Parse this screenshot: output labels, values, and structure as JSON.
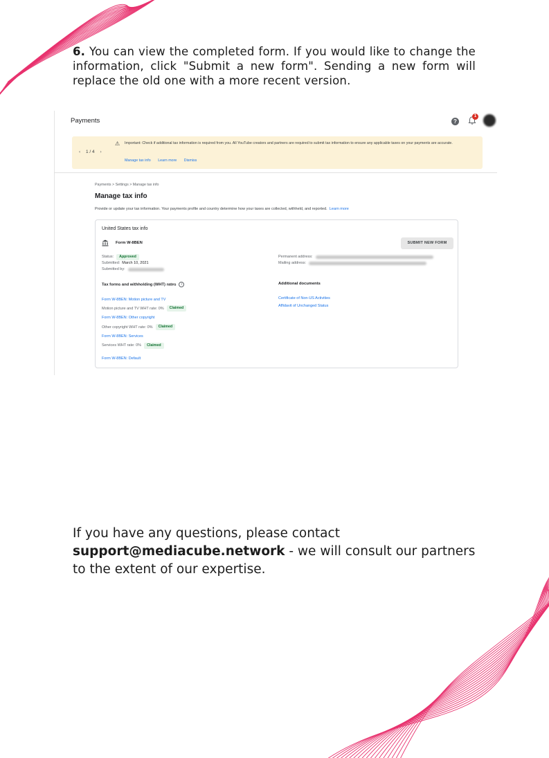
{
  "intro": {
    "step_num": "6.",
    "text": " You can view the completed form. If you would like to change the information, click \"Submit a new form\". Sending a new form will replace the old one with a more recent version."
  },
  "screenshot": {
    "topbar": {
      "title": "Payments",
      "notification_count": "1"
    },
    "banner": {
      "pager": "1 / 4",
      "prev_glyph": "‹",
      "next_glyph": "›",
      "text": "Important: Check if additional tax information is required from you. All YouTube creators and partners are required to submit tax information to ensure any applicable taxes on your payments are accurate.",
      "links": [
        "Manage tax info",
        "Learn more",
        "Dismiss"
      ]
    },
    "breadcrumb": "Payments  >  Settings  >  Manage tax info",
    "title": "Manage tax info",
    "description": "Provide or update your tax information. Your payments profile and country determine how your taxes are collected, withheld, and reported.",
    "description_link": "Learn more",
    "card": {
      "title": "United States tax info",
      "form_name": "Form W-8BEN",
      "submit_button": "SUBMIT NEW FORM",
      "status_label": "Status:",
      "status_value": "Approved",
      "submitted_label": "Submitted:",
      "submitted_value": "March 10, 2021",
      "submitted_by_label": "Submitted by:",
      "permanent_address_label": "Permanent address:",
      "mailing_address_label": "Mailing address:",
      "wht_heading": "Tax forms and withholding (WHT) rates",
      "wht_rows": {
        "r1": "Form W-8BEN: Motion picture and TV",
        "r2": "Motion picture and TV WHT rate: 0%",
        "r3": "Form W-8BEN: Other copyright",
        "r4": "Other copyright WHT rate: 0%",
        "r5": "Form W-8BEN: Services",
        "r6": "Services WHT rate: 0%",
        "r7": "Form W-8BEN: Default",
        "claimed": "Claimed"
      },
      "docs_heading": "Additional documents",
      "docs": [
        "Certificate of Non-US Activities",
        "Affidavit of Unchanged Status"
      ]
    }
  },
  "outro": {
    "line1": "If you have any questions, please contact",
    "email": "support@mediacube.network",
    "rest": " - we will consult our partners to the extent of our expertise."
  },
  "colors": {
    "accent_pink": "#e8336f",
    "link_blue": "#1a73e8",
    "banner_bg": "#fcf2d7",
    "chip_green": "#137333"
  }
}
